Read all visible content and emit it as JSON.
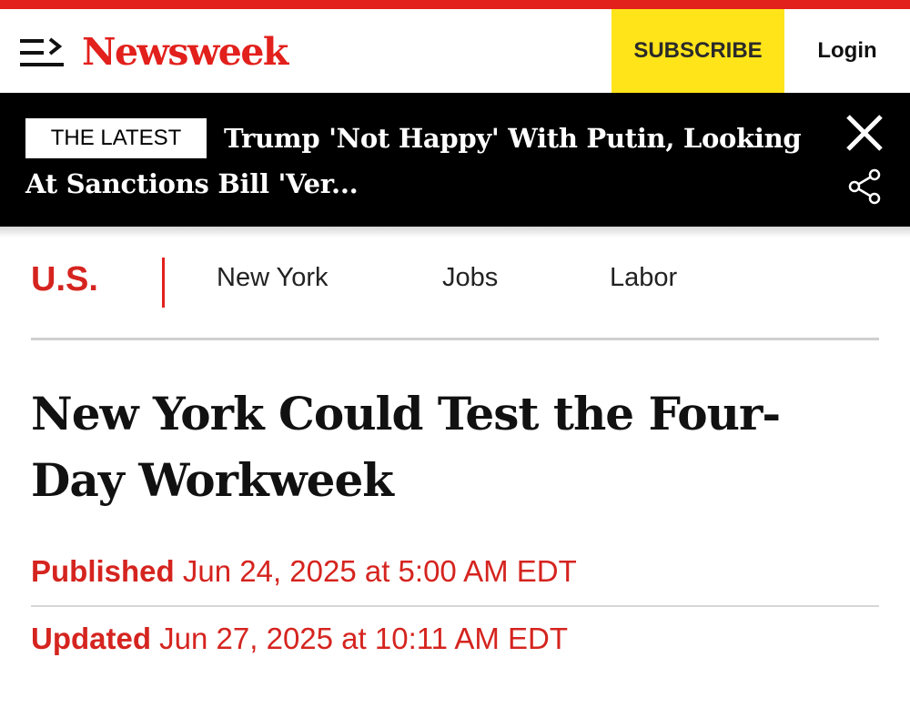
{
  "header": {
    "logo": "Newsweek",
    "subscribe_label": "SUBSCRIBE",
    "login_label": "Login",
    "menu_icon": "menu-arrow-icon"
  },
  "latest": {
    "badge": "THE LATEST",
    "headline": "Trump 'Not Happy' With Putin, Looking At Sanctions Bill 'Ver...",
    "close_icon": "close-icon",
    "share_icon": "share-icon"
  },
  "section_nav": {
    "main": "U.S.",
    "links": [
      "New York",
      "Jobs",
      "Labor"
    ]
  },
  "article": {
    "title": "New York Could Test the Four-Day Workweek",
    "published_label": "Published",
    "published_value": "Jun 24, 2025 at 5:00 AM EDT",
    "updated_label": "Updated",
    "updated_value": "Jun 27, 2025 at 10:11 AM EDT"
  },
  "colors": {
    "brand_red": "#e2201c",
    "subscribe_yellow": "#ffe41a",
    "banner_black": "#000000"
  }
}
